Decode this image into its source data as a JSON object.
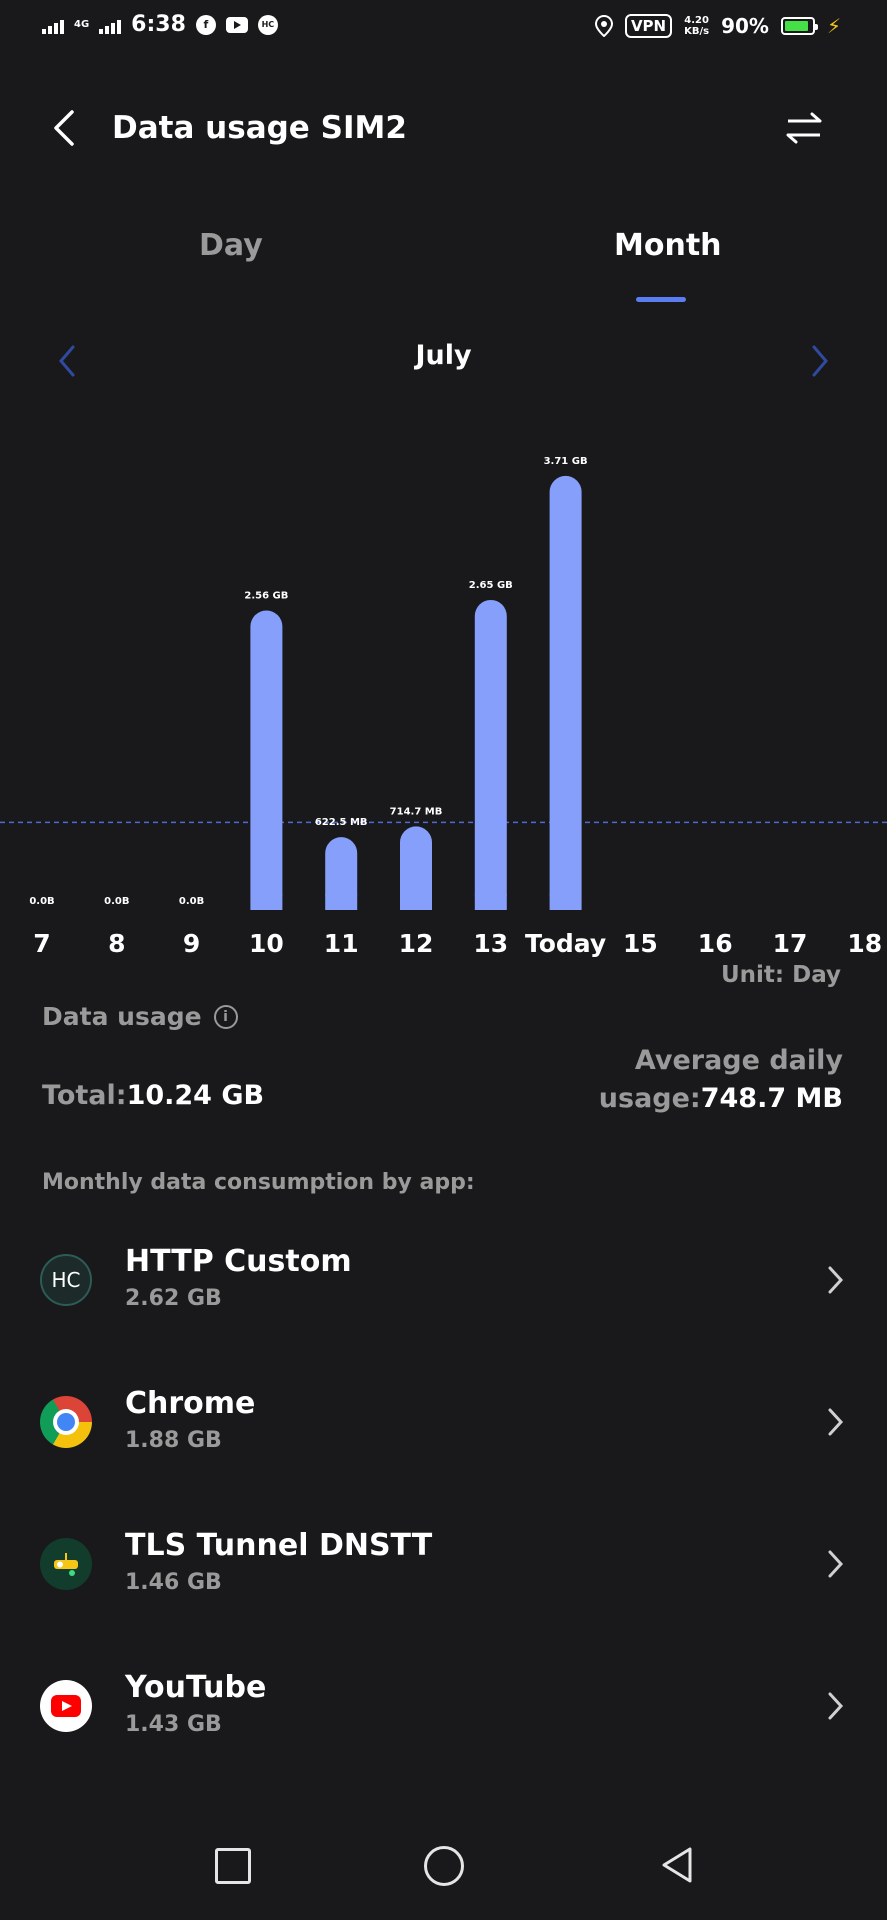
{
  "status_bar": {
    "network": "4G",
    "time": "6:38",
    "notification_icons": [
      "facebook-icon",
      "youtube-icon",
      "http-custom-icon"
    ],
    "vpn": "VPN",
    "speed_value": "4.20",
    "speed_unit": "KB/s",
    "battery": "90%",
    "battery_level": 0.9,
    "battery_color": "#45e048"
  },
  "header": {
    "title": "Data usage SIM2"
  },
  "tabs": [
    {
      "label": "Day",
      "active": false
    },
    {
      "label": "Month",
      "active": true
    }
  ],
  "month_nav": {
    "label": "July"
  },
  "chart_data": {
    "type": "bar",
    "categories": [
      "7",
      "8",
      "9",
      "10",
      "11",
      "12",
      "13",
      "Today",
      "15",
      "16",
      "17",
      "18"
    ],
    "values_gb": [
      0,
      0,
      0,
      2.56,
      0.6225,
      0.7147,
      2.65,
      3.71,
      null,
      null,
      null,
      null
    ],
    "value_labels": [
      "0.0B",
      "0.0B",
      "0.0B",
      "2.56 GB",
      "622.5 MB",
      "714.7 MB",
      "2.65 GB",
      "3.71 GB",
      "",
      "",
      "",
      ""
    ],
    "average_line_gb": 0.7487,
    "bar_color": "#859ffa",
    "avg_line_color": "#4b6bd8"
  },
  "unit": "Unit: Day",
  "usage": {
    "label": "Data usage",
    "total_label": "Total:",
    "total_value": "10.24 GB",
    "avg_label_line1": "Average daily",
    "avg_label_line2": "usage:",
    "avg_value": "748.7 MB"
  },
  "monthly_title": "Monthly data consumption by app:",
  "apps": [
    {
      "name": "HTTP Custom",
      "size": "2.62 GB",
      "icon": "http-custom-icon",
      "icon_text": "HC"
    },
    {
      "name": "Chrome",
      "size": "1.88 GB",
      "icon": "chrome-icon"
    },
    {
      "name": "TLS Tunnel DNSTT",
      "size": "1.46 GB",
      "icon": "tls-tunnel-icon"
    },
    {
      "name": "YouTube",
      "size": "1.43 GB",
      "icon": "youtube-icon"
    }
  ],
  "colors": {
    "background": "#19191b",
    "accent": "#5a7df2",
    "muted_text": "#9a9a9a"
  }
}
